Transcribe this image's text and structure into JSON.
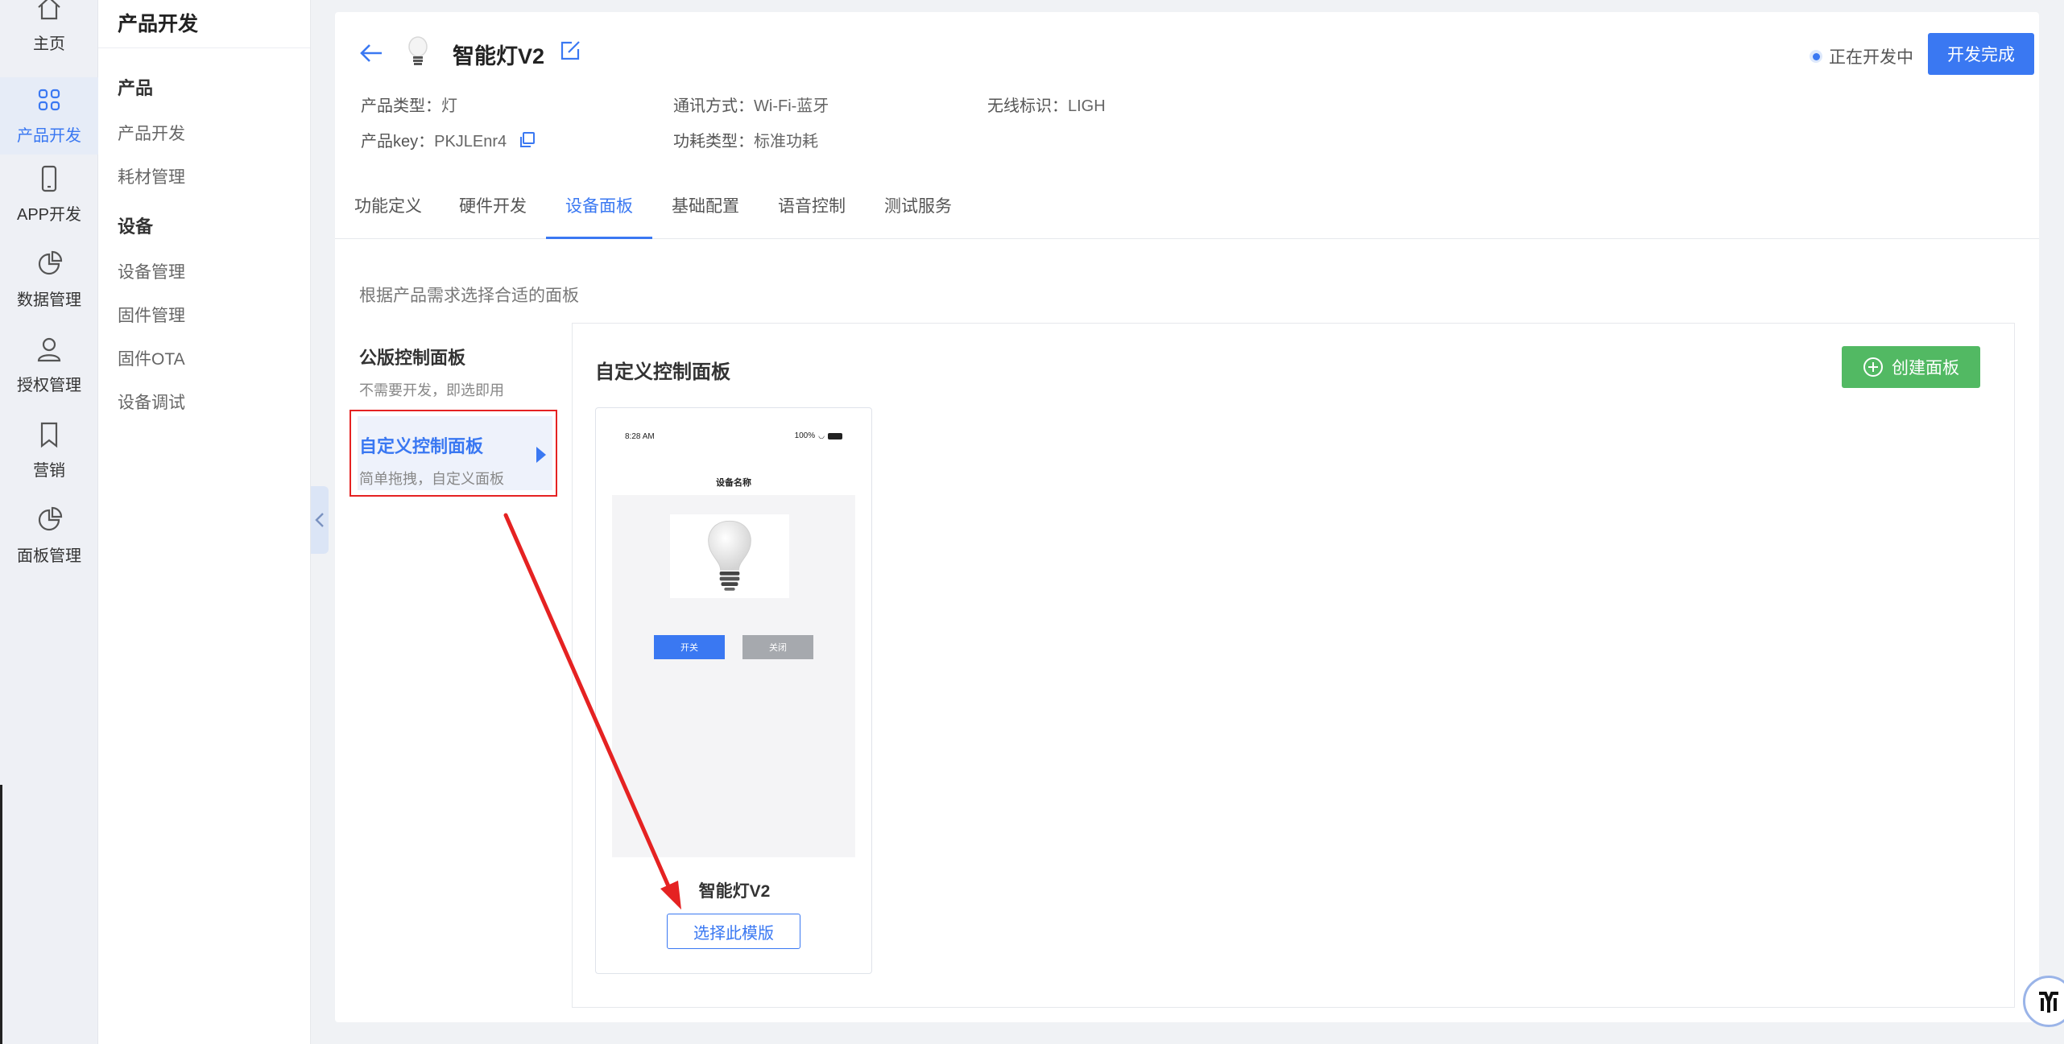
{
  "rail": {
    "items": [
      {
        "label": "主页",
        "icon": "home-icon"
      },
      {
        "label": "产品开发",
        "icon": "grid-icon",
        "active": true
      },
      {
        "label": "APP开发",
        "icon": "phone-icon"
      },
      {
        "label": "数据管理",
        "icon": "pie-chart-icon"
      },
      {
        "label": "授权管理",
        "icon": "user-icon"
      },
      {
        "label": "营销",
        "icon": "bookmark-icon"
      },
      {
        "label": "面板管理",
        "icon": "pie-chart-icon"
      }
    ]
  },
  "subnav": {
    "title": "产品开发",
    "groups": [
      {
        "label": "产品",
        "items": [
          "产品开发",
          "耗材管理"
        ]
      },
      {
        "label": "设备",
        "items": [
          "设备管理",
          "固件管理",
          "固件OTA",
          "设备调试"
        ]
      }
    ]
  },
  "header": {
    "product_name": "智能灯V2",
    "status": "正在开发中",
    "finish_button": "开发完成",
    "meta": {
      "type_label": "产品类型：",
      "type_value": "灯",
      "comm_label": "通讯方式：",
      "comm_value": "Wi-Fi-蓝牙",
      "wireless_label": "无线标识：",
      "wireless_value": "LIGH",
      "key_label": "产品key：",
      "key_value": "PKJLEnr4",
      "power_label": "功耗类型：",
      "power_value": "标准功耗"
    }
  },
  "tabs": [
    "功能定义",
    "硬件开发",
    "设备面板",
    "基础配置",
    "语音控制",
    "测试服务"
  ],
  "active_tab": "设备面板",
  "panel": {
    "hint": "根据产品需求选择合适的面板",
    "options": [
      {
        "title": "公版控制面板",
        "desc": "不需要开发，即选即用"
      },
      {
        "title": "自定义控制面板",
        "desc": "简单拖拽，自定义面板"
      }
    ],
    "selected_option": "自定义控制面板",
    "section_title": "自定义控制面板",
    "create_button": "创建面板",
    "template": {
      "phone_time": "8:28 AM",
      "phone_battery": "100%",
      "phone_title": "设备名称",
      "on_label": "开关",
      "off_label": "关闭",
      "name": "智能灯V2",
      "choose_button": "选择此模版"
    }
  },
  "colors": {
    "accent": "#3a78f2",
    "create_green": "#52b963",
    "annotation_red": "#e52222"
  }
}
